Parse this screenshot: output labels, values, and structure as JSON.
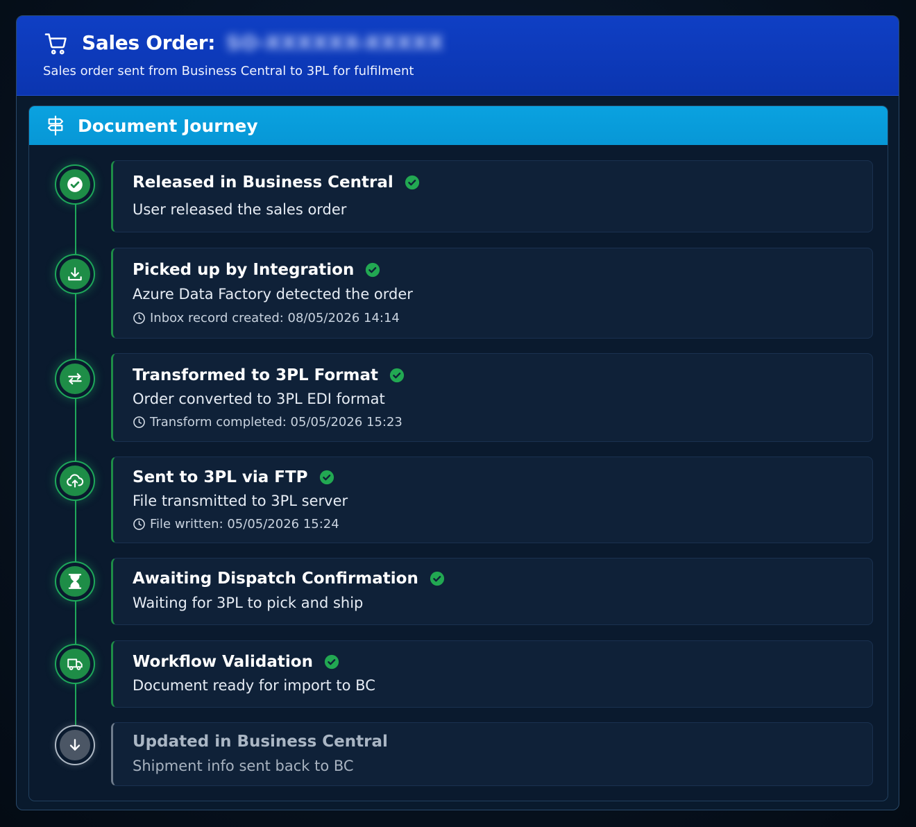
{
  "header": {
    "title": "Sales Order:",
    "order_number_redacted": "SO-XXXXXX-XXXXX",
    "subtitle": "Sales order sent from Business Central to 3PL for fulfilment"
  },
  "journey": {
    "title": "Document Journey",
    "steps": [
      {
        "title": "Released in Business Central",
        "description": "User released the sales order",
        "meta": "",
        "icon": "check-circle-icon",
        "status": "complete"
      },
      {
        "title": "Picked up by Integration",
        "description": "Azure Data Factory detected the order",
        "meta": "Inbox record created: 08/05/2026 14:14",
        "icon": "download-icon",
        "status": "complete"
      },
      {
        "title": "Transformed to 3PL Format",
        "description": "Order converted to 3PL EDI format",
        "meta": "Transform completed: 05/05/2026 15:23",
        "icon": "swap-arrows-icon",
        "status": "complete"
      },
      {
        "title": "Sent to 3PL via FTP",
        "description": "File transmitted to 3PL server",
        "meta": "File written: 05/05/2026 15:24",
        "icon": "cloud-upload-icon",
        "status": "complete"
      },
      {
        "title": "Awaiting Dispatch Confirmation",
        "description": "Waiting for 3PL to pick and ship",
        "meta": "",
        "icon": "hourglass-icon",
        "status": "complete"
      },
      {
        "title": "Workflow Validation",
        "description": "Document ready for import to BC",
        "meta": "",
        "icon": "truck-icon",
        "status": "complete"
      },
      {
        "title": "Updated in Business Central",
        "description": "Shipment info sent back to BC",
        "meta": "",
        "icon": "arrow-down-icon",
        "status": "pending"
      }
    ]
  },
  "colors": {
    "header_blue": "#0f3fc4",
    "journey_header": "#0aa2e0",
    "complete_green": "#1e8d47",
    "check_green": "#22a852",
    "pending_gray": "#4b5665"
  }
}
